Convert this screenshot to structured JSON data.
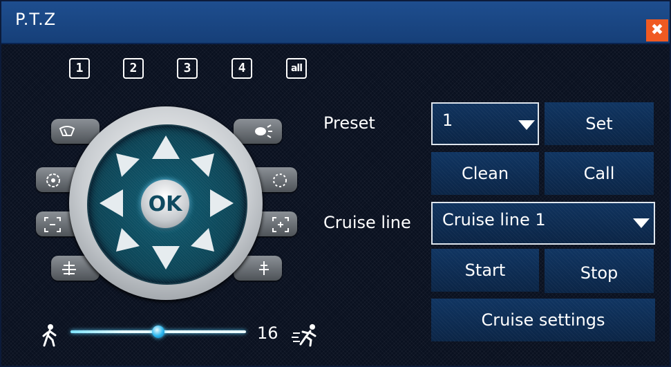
{
  "window": {
    "title": "P.T.Z",
    "close_glyph": "✖"
  },
  "channels": [
    "1",
    "2",
    "3",
    "4",
    "all"
  ],
  "joystick": {
    "ok_label": "OK"
  },
  "speed": {
    "value": "16",
    "level_fraction": 0.5
  },
  "preset": {
    "label": "Preset",
    "selected": "1",
    "set_label": "Set",
    "clean_label": "Clean",
    "call_label": "Call"
  },
  "cruise": {
    "label": "Cruise line",
    "selected": "Cruise line 1",
    "start_label": "Start",
    "stop_label": "Stop",
    "settings_label": "Cruise settings"
  },
  "colors": {
    "titlebar": "#1b4785",
    "close": "#f05a22",
    "background": "#0a1120",
    "button": "#0e2d52",
    "accent": "#2bb7ef"
  }
}
